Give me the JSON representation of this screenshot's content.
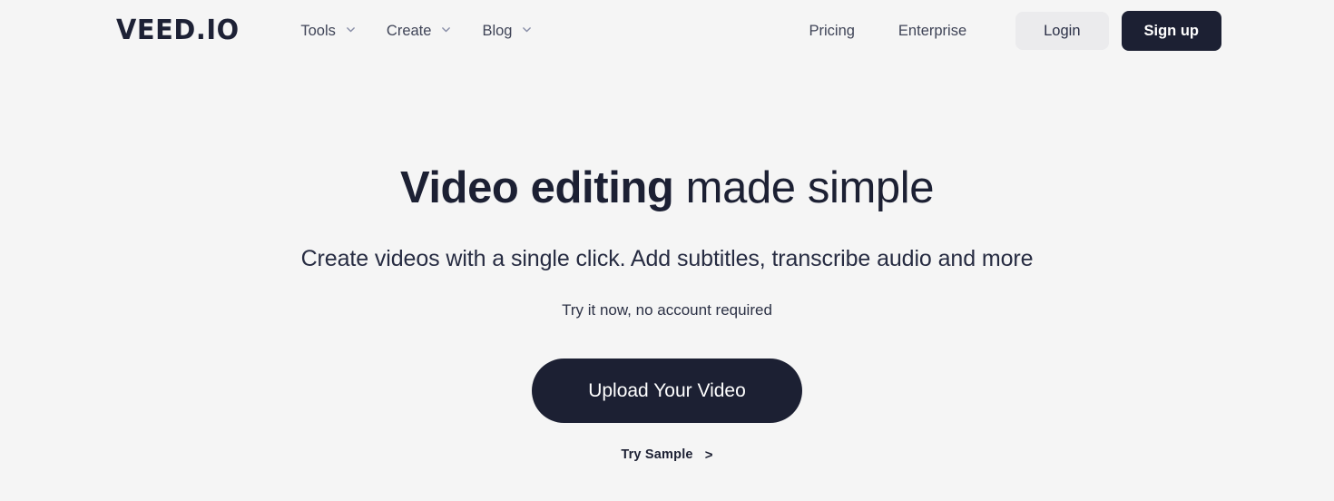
{
  "colors": {
    "background": "#f5f5f5",
    "ink": "#1c2033",
    "nav_text": "#3f4457",
    "login_bg": "#ebebed",
    "chevron": "#8a8fa8"
  },
  "header": {
    "logo": "VEED.IO",
    "nav": [
      {
        "label": "Tools",
        "icon": "chevron-down-icon"
      },
      {
        "label": "Create",
        "icon": "chevron-down-icon"
      },
      {
        "label": "Blog",
        "icon": "chevron-down-icon"
      }
    ],
    "links": [
      {
        "label": "Pricing"
      },
      {
        "label": "Enterprise"
      }
    ],
    "login_label": "Login",
    "signup_label": "Sign up"
  },
  "hero": {
    "title_strong": "Video editing",
    "title_rest": " made simple",
    "subtitle": "Create videos with a single click. Add subtitles, transcribe audio and more",
    "note": "Try it now, no account required",
    "cta_label": "Upload Your Video",
    "try_sample_label": "Try Sample",
    "try_sample_arrow": ">"
  }
}
